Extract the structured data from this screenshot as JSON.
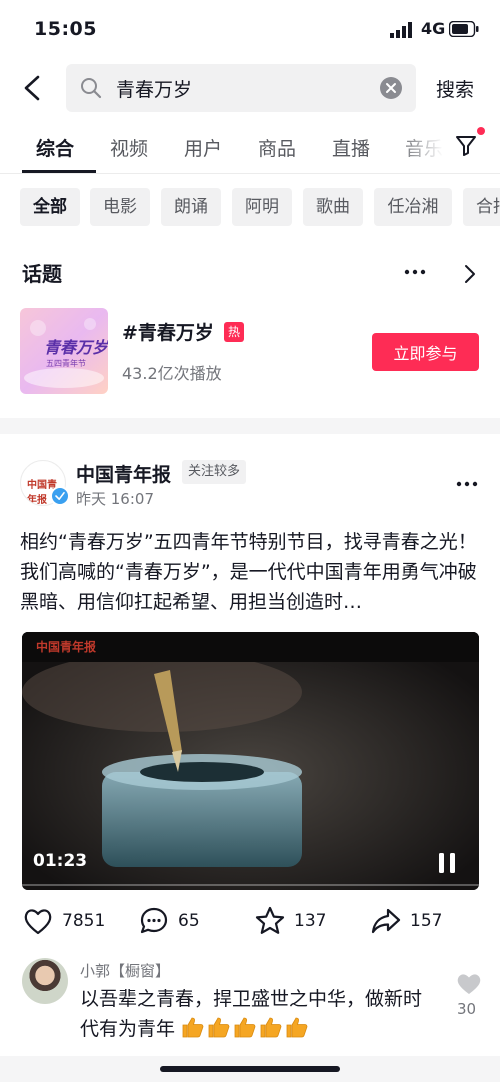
{
  "status_bar": {
    "time": "15:05",
    "network": "4G"
  },
  "search": {
    "query": "青春万岁",
    "button_label": "搜索"
  },
  "tabs": [
    "综合",
    "视频",
    "用户",
    "商品",
    "直播",
    "音乐"
  ],
  "chips": [
    "全部",
    "电影",
    "朗诵",
    "阿明",
    "歌曲",
    "任冶湘",
    "合拍"
  ],
  "topic": {
    "section_title": "话题",
    "name": "#青春万岁",
    "hot_badge": "热",
    "plays": "43.2亿次播放",
    "join_label": "立即参与",
    "thumb_text": "青春万岁",
    "thumb_sub": "五四青年节"
  },
  "post": {
    "author": "中国青年报",
    "follow_badge": "关注较多",
    "time": "昨天 16:07",
    "text": "相约“青春万岁”五四青年节特别节目，找寻青春之光！我们高喊的“青春万岁”，是一代代中国青年用勇气冲破黑暗、用信仰扛起希望、用担当创造时…",
    "avatar_text": "中国青年报",
    "video_watermark": "中国青年报",
    "video_duration": "01:23",
    "likes": "7851",
    "comments": "65",
    "favorites": "137",
    "shares": "157"
  },
  "comment": {
    "user": "小郭【橱窗】",
    "text": "以吾辈之青春，捍卫盛世之中华，做新时代有为青年",
    "likes": "30"
  },
  "colors": {
    "accent": "#fe2c55",
    "text": "#161823",
    "secondary": "#73757b",
    "verified": "#3aa0f0"
  }
}
